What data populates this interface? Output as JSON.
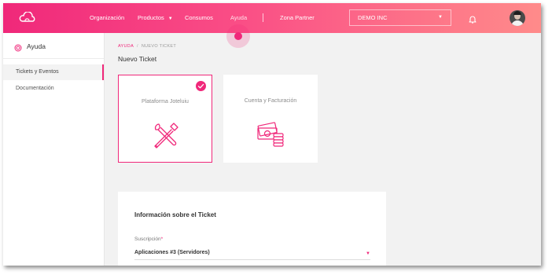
{
  "topbar": {
    "nav": [
      {
        "label": "Organización"
      },
      {
        "label": "Productos",
        "caret": "▼"
      },
      {
        "label": "Consumos"
      },
      {
        "label": "Ayuda",
        "active": true
      },
      {
        "label": "Zona Partner"
      }
    ],
    "company": {
      "value": "DEMO INC",
      "caret": "▼"
    },
    "icons": [
      "cloud-logo-icon",
      "bell-icon",
      "avatar"
    ]
  },
  "sidebar": {
    "title": "Ayuda",
    "items": [
      {
        "label": "Tickets y Eventos",
        "active": true
      },
      {
        "label": "Documentación"
      }
    ]
  },
  "breadcrumb": {
    "items": [
      "AYUDA",
      "NUEVO TICKET"
    ],
    "separator": "/"
  },
  "page_title": "Nuevo Ticket",
  "cards": [
    {
      "label": "Plataforma Joteluiu",
      "selected": true,
      "icon": "tools-icon"
    },
    {
      "label": "Cuenta y Facturación",
      "selected": false,
      "icon": "money-icon"
    }
  ],
  "form": {
    "heading": "Información sobre el Ticket",
    "subscription_label": "Suscripción",
    "required_mark": "*",
    "subscription_value": "Aplicaciones #3 (Servidores)",
    "caret": "▼"
  },
  "colors": {
    "accent": "#f0287a",
    "gradient_end": "#ff8b8a"
  }
}
